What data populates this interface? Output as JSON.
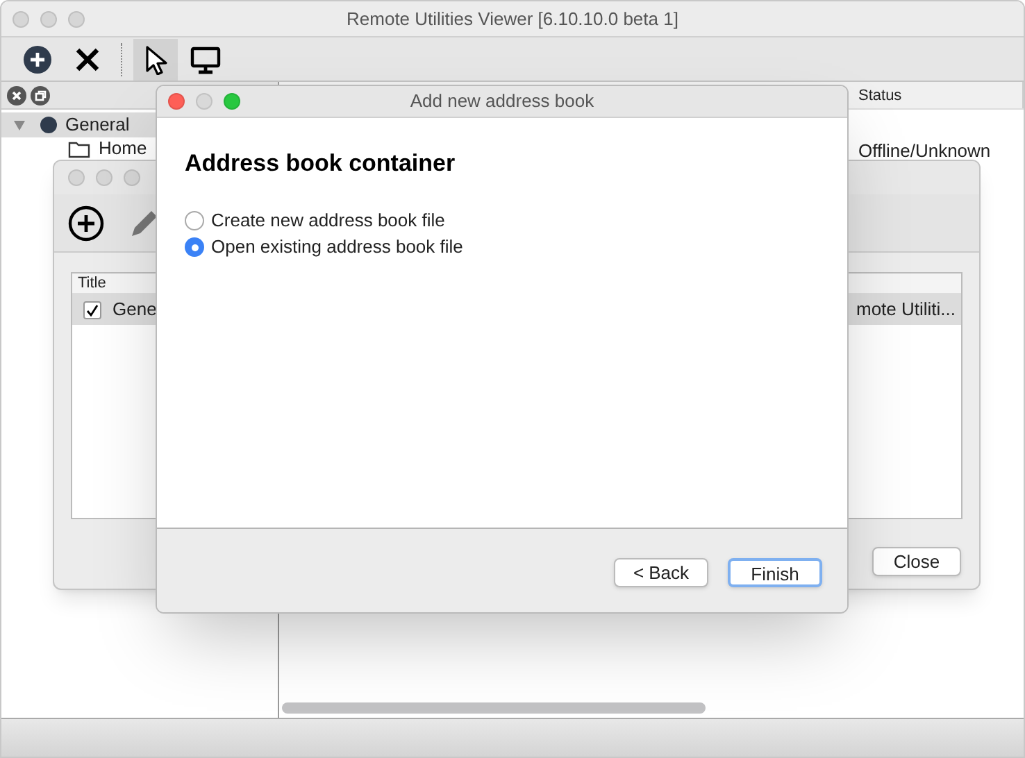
{
  "main_window": {
    "title": "Remote Utilities Viewer [6.10.10.0 beta 1]",
    "toolbar": [
      {
        "kind": "add",
        "selected": false
      },
      {
        "kind": "delete",
        "selected": false
      },
      {
        "kind": "pointer",
        "selected": true
      },
      {
        "kind": "monitor",
        "selected": false
      }
    ],
    "tree": [
      {
        "label": "General",
        "expanded": true,
        "selected": true,
        "children": [
          {
            "label": "Home"
          }
        ]
      }
    ],
    "table": {
      "columns": [
        "Status"
      ],
      "rows": [
        {
          "status": "Offline/Unknown"
        }
      ]
    }
  },
  "address_books_window": {
    "list": {
      "columns": [
        "Title"
      ],
      "rows": [
        {
          "checked": true,
          "title": "Gene",
          "column_2": "mote Utiliti...",
          "selected": true
        }
      ]
    },
    "buttons": [
      "Close"
    ]
  },
  "dialog": {
    "title": "Add new address book",
    "heading": "Address book container",
    "options": [
      {
        "label": "Create new address book file",
        "selected": false
      },
      {
        "label": "Open existing address book file",
        "selected": true
      }
    ],
    "buttons": [
      {
        "label": "< Back",
        "default": false
      },
      {
        "label": "Finish",
        "default": true
      }
    ]
  }
}
